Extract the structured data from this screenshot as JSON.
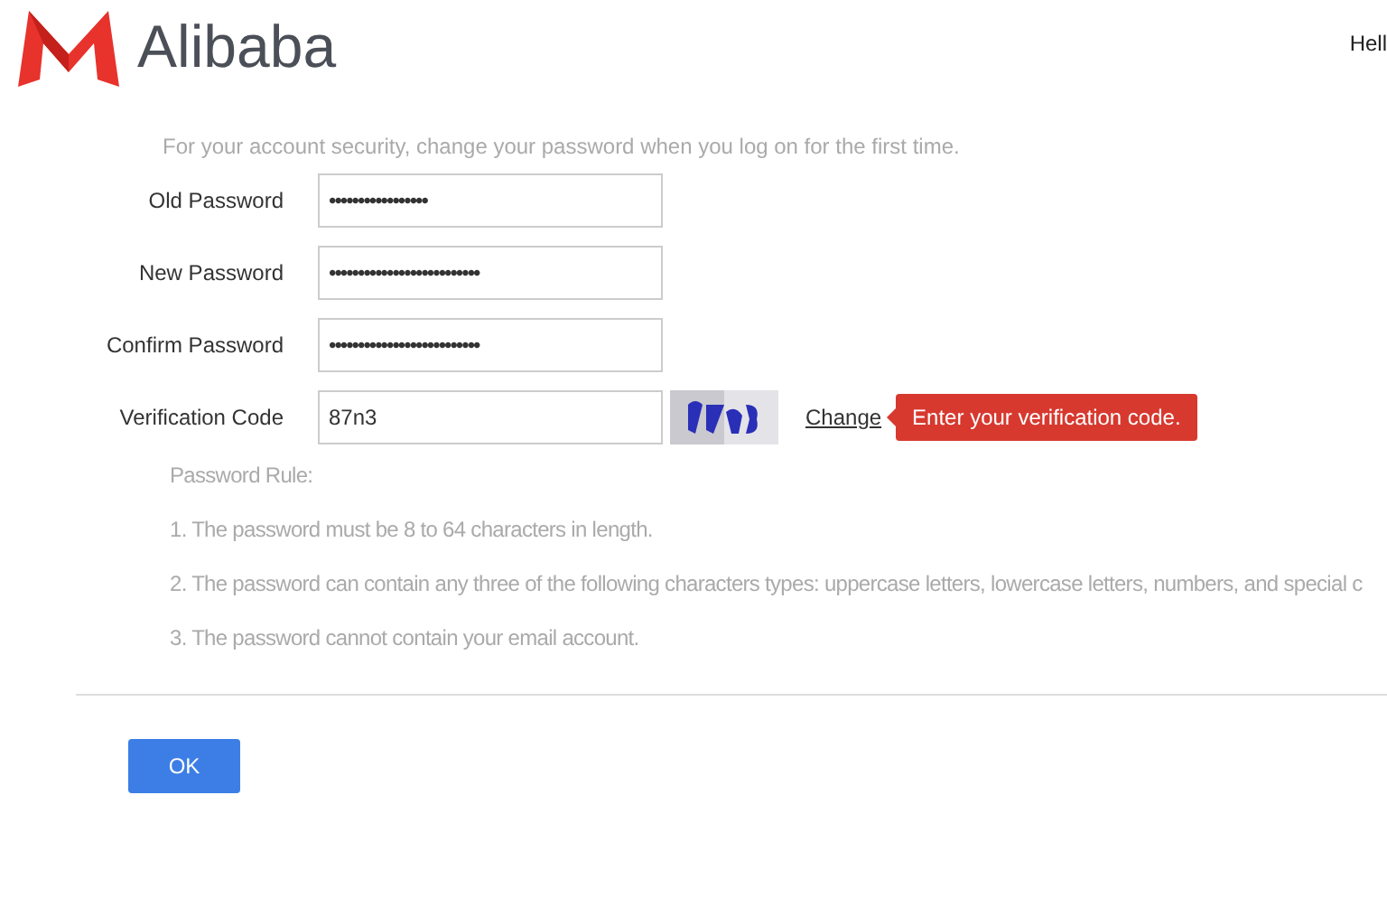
{
  "header": {
    "logo_text": "Alibaba",
    "greeting": "Hell"
  },
  "intro": "For your account security, change your password when you log on for the first time.",
  "fields": [
    {
      "kind": "password",
      "label": "Old Password",
      "value": "•••••••••••••••••"
    },
    {
      "kind": "password",
      "label": "New Password",
      "value": "••••••••••••••••••••••••••"
    },
    {
      "kind": "password",
      "label": "Confirm Password",
      "value": "••••••••••••••••••••••••••"
    },
    {
      "kind": "captcha",
      "label": "Verification Code",
      "value": "87n3",
      "link": "Change",
      "error": "Enter your verification code."
    }
  ],
  "rules": {
    "title": "Password Rule:",
    "items": [
      "1. The password must be 8 to 64 characters in length.",
      "2. The password can contain any three of the following characters types: uppercase letters, lowercase letters, numbers, and special c",
      "3. The password cannot contain your email account."
    ]
  },
  "buttons": [
    "OK"
  ]
}
